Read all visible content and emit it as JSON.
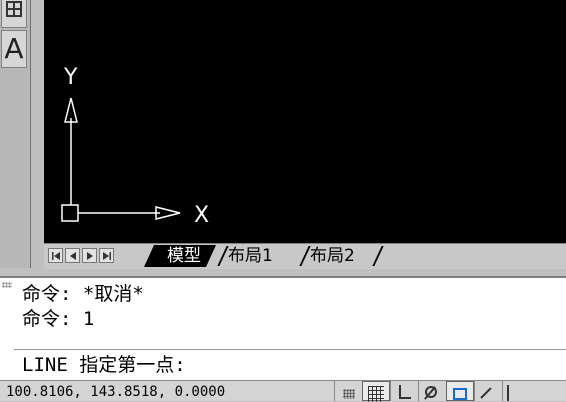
{
  "toolbar": {
    "text_tool_glyph": "A"
  },
  "ucs": {
    "y_label": "Y",
    "x_label": "X"
  },
  "layout_tabs": {
    "items": [
      {
        "label": "模型",
        "active": true
      },
      {
        "label": "布局1",
        "active": false
      },
      {
        "label": "布局2",
        "active": false
      }
    ]
  },
  "command": {
    "history": [
      "命令: *取消*",
      "命令: 1"
    ],
    "prompt": "LINE 指定第一点:"
  },
  "status": {
    "coords": "100.8106, 143.8518, 0.0000",
    "icons": [
      "snap-icon",
      "grid-icon",
      "ortho-icon",
      "polar-icon",
      "osnap-icon",
      "otrack-icon",
      "more-icon"
    ]
  },
  "colors": {
    "canvas_bg": "#000000",
    "ucs_stroke": "#ffffff",
    "osnap_accent": "#1a6ad0"
  }
}
